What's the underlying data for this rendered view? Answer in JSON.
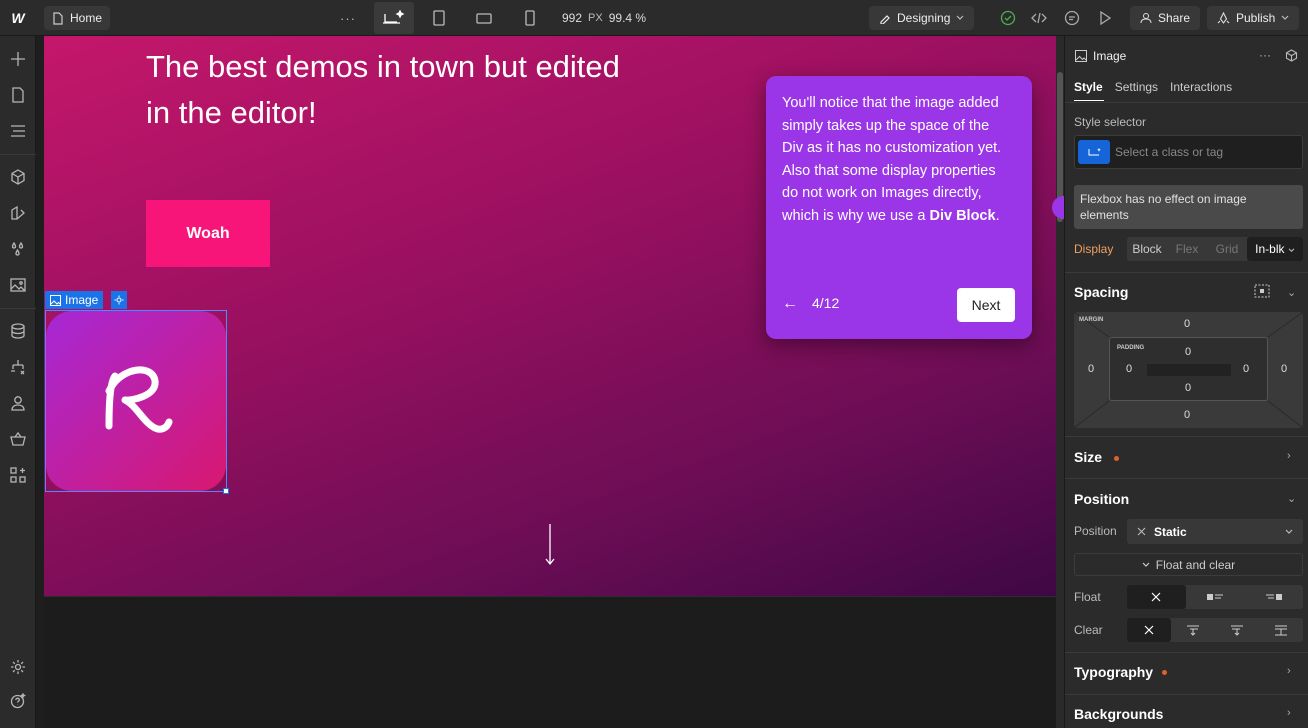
{
  "topbar": {
    "logo": "W",
    "home_label": "Home",
    "more": "···",
    "canvas_width": "992",
    "canvas_unit": "PX",
    "zoom": "99.4 %",
    "mode_label": "Designing",
    "share_label": "Share",
    "publish_label": "Publish"
  },
  "canvas": {
    "hero_title": "The best demos in town but edited in the editor!",
    "button_label": "Woah",
    "selected_label": "Image"
  },
  "tooltip": {
    "text_before": "You'll notice that the image added simply takes up the space of the Div as it has no customization yet. Also that some display properties do not work on Images directly, which is why we use a ",
    "text_bold": "Div Block",
    "text_after": ".",
    "back": "←",
    "progress": "4/12",
    "next_label": "Next"
  },
  "panel": {
    "element_name": "Image",
    "tabs": [
      "Style",
      "Settings",
      "Interactions"
    ],
    "style_selector_label": "Style selector",
    "selector_placeholder": "Select a class or tag",
    "warning": "Flexbox has no effect on image elements",
    "display_label": "Display",
    "display_options": [
      "Block",
      "Flex",
      "Grid",
      "In-blk"
    ],
    "spacing_title": "Spacing",
    "margin_label": "MARGIN",
    "padding_label": "PADDING",
    "margin": {
      "top": "0",
      "right": "0",
      "bottom": "0",
      "left": "0"
    },
    "padding": {
      "top": "0",
      "right": "0",
      "bottom": "0",
      "left": "0"
    },
    "size_title": "Size",
    "position_title": "Position",
    "position_label": "Position",
    "position_value": "Static",
    "float_clear_label": "Float and clear",
    "float_label": "Float",
    "clear_label": "Clear",
    "typography_title": "Typography",
    "backgrounds_title": "Backgrounds"
  },
  "colors": {
    "accent": "#9b36e8",
    "button_pink": "#f7157a",
    "selection_blue": "#1a73e8",
    "modified_dot": "#e0622a"
  }
}
